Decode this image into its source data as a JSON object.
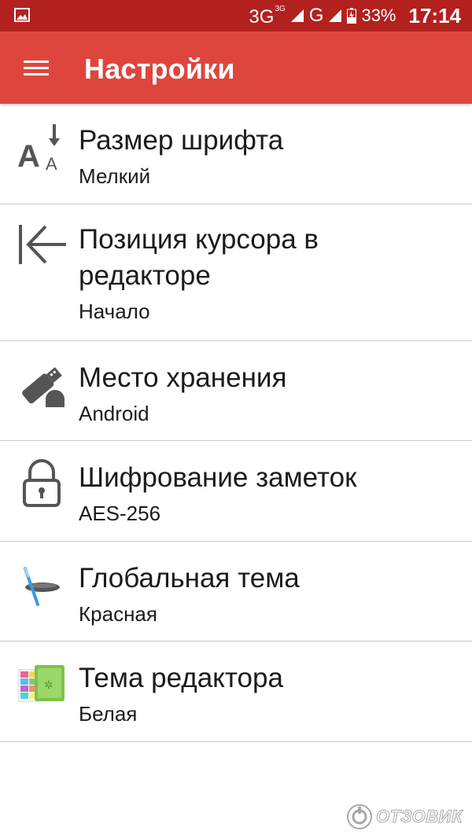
{
  "status_bar": {
    "network_1": "3G",
    "network_1_sup": "3G",
    "network_2": "G",
    "battery_percent": "33%",
    "time": "17:14"
  },
  "app_bar": {
    "title": "Настройки"
  },
  "settings": [
    {
      "icon": "font-size-icon",
      "title": "Размер шрифта",
      "value": "Мелкий"
    },
    {
      "icon": "cursor-position-icon",
      "title": "Позиция курсора в редакторе",
      "value": "Начало"
    },
    {
      "icon": "usb-storage-icon",
      "title": "Место хранения",
      "value": "Android"
    },
    {
      "icon": "lock-icon",
      "title": "Шифрование заметок",
      "value": "AES-256"
    },
    {
      "icon": "theme-brush-icon",
      "title": "Глобальная тема",
      "value": "Красная"
    },
    {
      "icon": "editor-theme-icon",
      "title": "Тема редактора",
      "value": "Белая"
    }
  ],
  "watermark": {
    "text": "ОТЗОВИК"
  },
  "colors": {
    "status_bar": "#b3211f",
    "app_bar": "#de463d",
    "divider": "#c8c8c8",
    "icon_gray": "#555555"
  }
}
